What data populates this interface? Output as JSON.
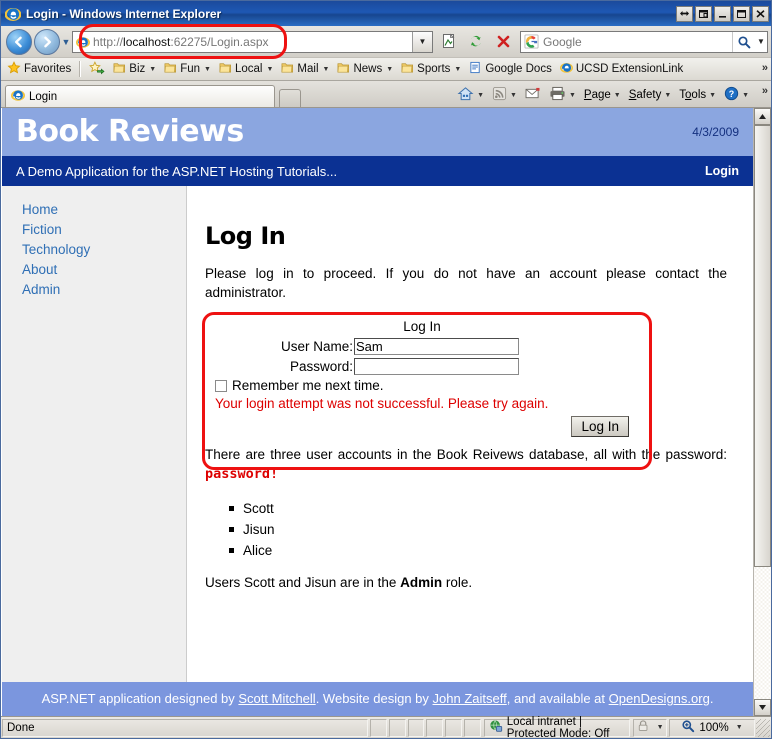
{
  "browser": {
    "title": "Login - Windows Internet Explorer",
    "window_controls": [
      "restore-size",
      "restore-window",
      "minimize",
      "maximize",
      "close"
    ],
    "address": {
      "scheme": "http://",
      "host": "localhost",
      "rest": ":62275/Login.aspx",
      "full_url": "http://localhost:62275/Login.aspx"
    },
    "search": {
      "provider": "Google",
      "placeholder": "Google"
    },
    "toolbar_buttons": [
      "compatibility-view",
      "refresh",
      "stop"
    ],
    "favorites": {
      "label": "Favorites",
      "items": [
        {
          "label": "Biz",
          "icon": "folder-icon",
          "caret": true
        },
        {
          "label": "Fun",
          "icon": "folder-icon",
          "caret": true
        },
        {
          "label": "Local",
          "icon": "folder-icon",
          "caret": true
        },
        {
          "label": "Mail",
          "icon": "folder-icon",
          "caret": true
        },
        {
          "label": "News",
          "icon": "folder-icon",
          "caret": true
        },
        {
          "label": "Sports",
          "icon": "folder-icon",
          "caret": true
        },
        {
          "label": "Google Docs",
          "icon": "document-icon",
          "caret": false
        },
        {
          "label": "UCSD ExtensionLink",
          "icon": "ie-icon",
          "caret": false
        }
      ],
      "overflow": "»"
    },
    "tabs": [
      {
        "label": "Login",
        "active": true
      }
    ],
    "command_bar": [
      {
        "label": "Home",
        "icon": "home-icon",
        "caret": true
      },
      {
        "label": "Feeds",
        "icon": "rss-icon",
        "caret": true
      },
      {
        "label": "Read Mail",
        "icon": "mail-icon",
        "caret": false
      },
      {
        "label": "Print",
        "icon": "printer-icon",
        "caret": true
      },
      {
        "label": "Page",
        "icon": "",
        "caret": true
      },
      {
        "label": "Safety",
        "icon": "",
        "caret": true
      },
      {
        "label": "Tools",
        "icon": "",
        "caret": true
      },
      {
        "label": "Help",
        "icon": "help-icon",
        "caret": true
      }
    ],
    "command_bar_overflow": "»",
    "statusbar": {
      "status": "Done",
      "zone": "Local intranet | Protected Mode: Off",
      "zoom": "100%"
    }
  },
  "site": {
    "title": "Book Reviews",
    "date": "4/3/2009",
    "tagline": "A Demo Application for the ASP.NET Hosting Tutorials...",
    "login_link": "Login",
    "sidebar": [
      {
        "label": "Home"
      },
      {
        "label": "Fiction"
      },
      {
        "label": "Technology"
      },
      {
        "label": "About"
      },
      {
        "label": "Admin"
      }
    ],
    "main": {
      "heading": "Log In",
      "intro": "Please log in to proceed. If you do not have an account please contact the administrator.",
      "login_form": {
        "caption": "Log In",
        "username_label": "User Name:",
        "username_value": "Sam",
        "password_label": "Password:",
        "password_value": "",
        "remember_label": "Remember me next time.",
        "remember_checked": false,
        "error": "Your login attempt was not successful. Please try again.",
        "submit_label": "Log In"
      },
      "accounts_text_part1": "There are three user accounts in the Book Reivews database, all with the password: ",
      "accounts_password": "password!",
      "accounts": [
        "Scott",
        "Jisun",
        "Alice"
      ],
      "roles_part1": "Users Scott and Jisun are in the ",
      "roles_bold": "Admin",
      "roles_part2": " role."
    },
    "footer": {
      "part1": "ASP.NET application designed by ",
      "link1": "Scott Mitchell",
      "part2": ". Website design by ",
      "link2": "John Zaitseff",
      "part3": ", and available at ",
      "link3": "OpenDesigns.org",
      "part4": "."
    }
  },
  "annotations": {
    "highlight_color": "#ee1111",
    "shapes": [
      "address-bar-ellipse",
      "login-form-box"
    ]
  },
  "colors": {
    "banner": "#8ba6e0",
    "subbar": "#0b3193",
    "footer": "#7b96de",
    "sidebar_bg": "#efefef",
    "link": "#2f6fb5",
    "error": "#dd0000"
  }
}
